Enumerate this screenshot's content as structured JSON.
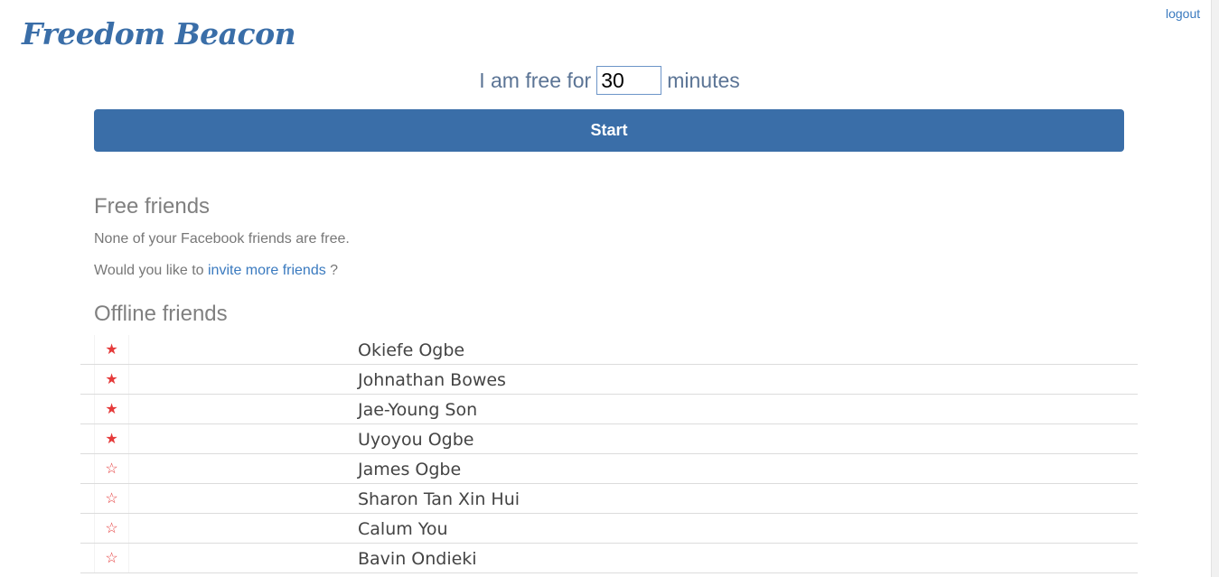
{
  "app": {
    "logo": "Freedom Beacon",
    "logout_label": "logout"
  },
  "status": {
    "prefix": "I am free for",
    "minutes_value": "30",
    "suffix": "minutes",
    "start_label": "Start"
  },
  "free_friends": {
    "heading": "Free friends",
    "none_message": "None of your Facebook friends are free.",
    "invite_prefix": "Would you like to",
    "invite_link": "invite more friends",
    "invite_suffix": "?"
  },
  "offline_friends": {
    "heading": "Offline friends",
    "rows": [
      {
        "name": "Okiefe Ogbe",
        "star": "★",
        "favorite": true
      },
      {
        "name": "Johnathan Bowes",
        "star": "★",
        "favorite": true
      },
      {
        "name": "Jae-Young Son",
        "star": "★",
        "favorite": true
      },
      {
        "name": "Uyoyou Ogbe",
        "star": "★",
        "favorite": true
      },
      {
        "name": "James Ogbe",
        "star": "☆",
        "favorite": false
      },
      {
        "name": "Sharon Tan Xin Hui",
        "star": "☆",
        "favorite": false
      },
      {
        "name": "Calum You",
        "star": "☆",
        "favorite": false
      },
      {
        "name": "Bavin Ondieki",
        "star": "☆",
        "favorite": false
      }
    ]
  },
  "colors": {
    "brand": "#3a6ea8",
    "star": "#e53a3a",
    "link": "#3a7abf"
  }
}
